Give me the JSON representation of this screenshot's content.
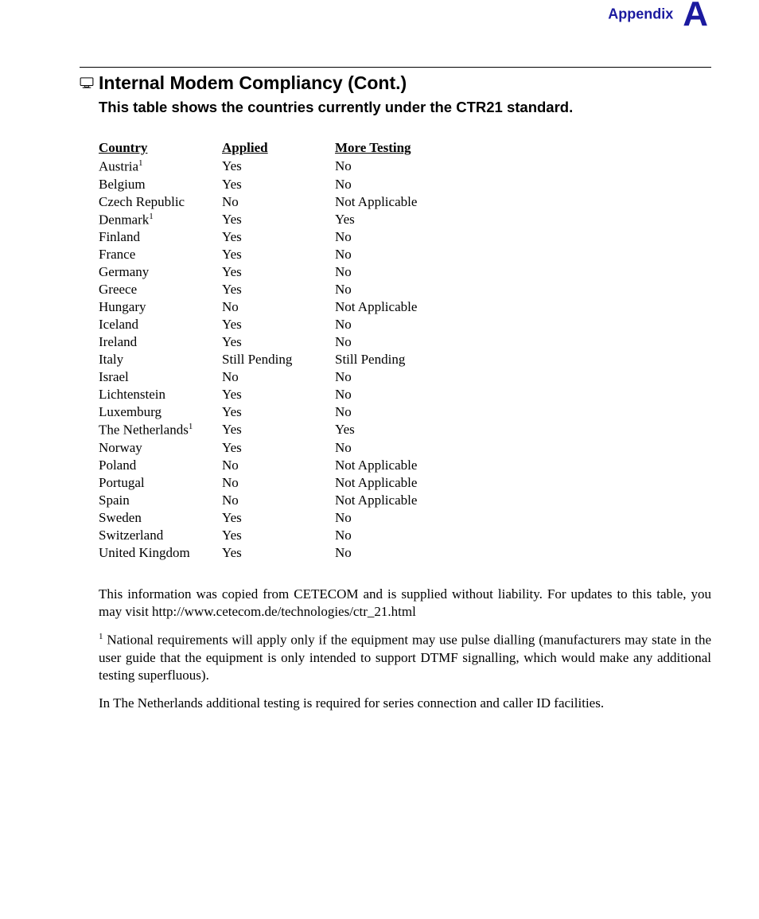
{
  "header": {
    "appendix_label": "Appendix",
    "appendix_letter": "A"
  },
  "title": "Internal Modem Compliancy (Cont.)",
  "subtitle": "This table shows the countries currently under the CTR21 standard.",
  "icon": "monitor-icon",
  "table": {
    "headers": {
      "country": "Country",
      "applied": "Applied",
      "more": "More Testing"
    },
    "rows": [
      {
        "country": "Austria",
        "footnote": "1",
        "applied": "Yes",
        "more": "No"
      },
      {
        "country": "Belgium",
        "footnote": "",
        "applied": "Yes",
        "more": "No"
      },
      {
        "country": "Czech Republic",
        "footnote": "",
        "applied": "No",
        "more": "Not Applicable"
      },
      {
        "country": "Denmark",
        "footnote": "1",
        "applied": "Yes",
        "more": "Yes"
      },
      {
        "country": "Finland",
        "footnote": "",
        "applied": "Yes",
        "more": "No"
      },
      {
        "country": "France",
        "footnote": "",
        "applied": "Yes",
        "more": "No"
      },
      {
        "country": "Germany",
        "footnote": "",
        "applied": "Yes",
        "more": "No"
      },
      {
        "country": "Greece",
        "footnote": "",
        "applied": "Yes",
        "more": "No"
      },
      {
        "country": "Hungary",
        "footnote": "",
        "applied": "No",
        "more": "Not Applicable"
      },
      {
        "country": "Iceland",
        "footnote": "",
        "applied": "Yes",
        "more": "No"
      },
      {
        "country": "Ireland",
        "footnote": "",
        "applied": "Yes",
        "more": "No"
      },
      {
        "country": "Italy",
        "footnote": "",
        "applied": "Still Pending",
        "more": "Still Pending"
      },
      {
        "country": "Israel",
        "footnote": "",
        "applied": "No",
        "more": "No"
      },
      {
        "country": "Lichtenstein",
        "footnote": "",
        "applied": "Yes",
        "more": "No"
      },
      {
        "country": "Luxemburg",
        "footnote": "",
        "applied": "Yes",
        "more": "No"
      },
      {
        "country": "The Netherlands",
        "footnote": "1",
        "applied": "Yes",
        "more": "Yes"
      },
      {
        "country": "Norway",
        "footnote": "",
        "applied": "Yes",
        "more": "No"
      },
      {
        "country": "Poland",
        "footnote": "",
        "applied": "No",
        "more": "Not Applicable"
      },
      {
        "country": "Portugal",
        "footnote": "",
        "applied": "No",
        "more": "Not Applicable"
      },
      {
        "country": "Spain",
        "footnote": "",
        "applied": "No",
        "more": "Not Applicable"
      },
      {
        "country": "Sweden",
        "footnote": "",
        "applied": "Yes",
        "more": "No"
      },
      {
        "country": "Switzerland",
        "footnote": "",
        "applied": "Yes",
        "more": "No"
      },
      {
        "country": "United Kingdom",
        "footnote": "",
        "applied": "Yes",
        "more": "No"
      }
    ]
  },
  "paragraphs": {
    "p1": "This information was copied from CETECOM and is supplied without liability. For updates to this table, you may visit http://www.cetecom.de/technologies/ctr_21.html",
    "p2_fn": "1",
    "p2": " National requirements will apply only if the equipment may use pulse dialling (manufacturers may state in the user guide that the equipment is only intended to support DTMF signalling, which would make any additional testing superfluous).",
    "p3": "In The Netherlands additional testing is required for series connection and caller ID facilities."
  }
}
